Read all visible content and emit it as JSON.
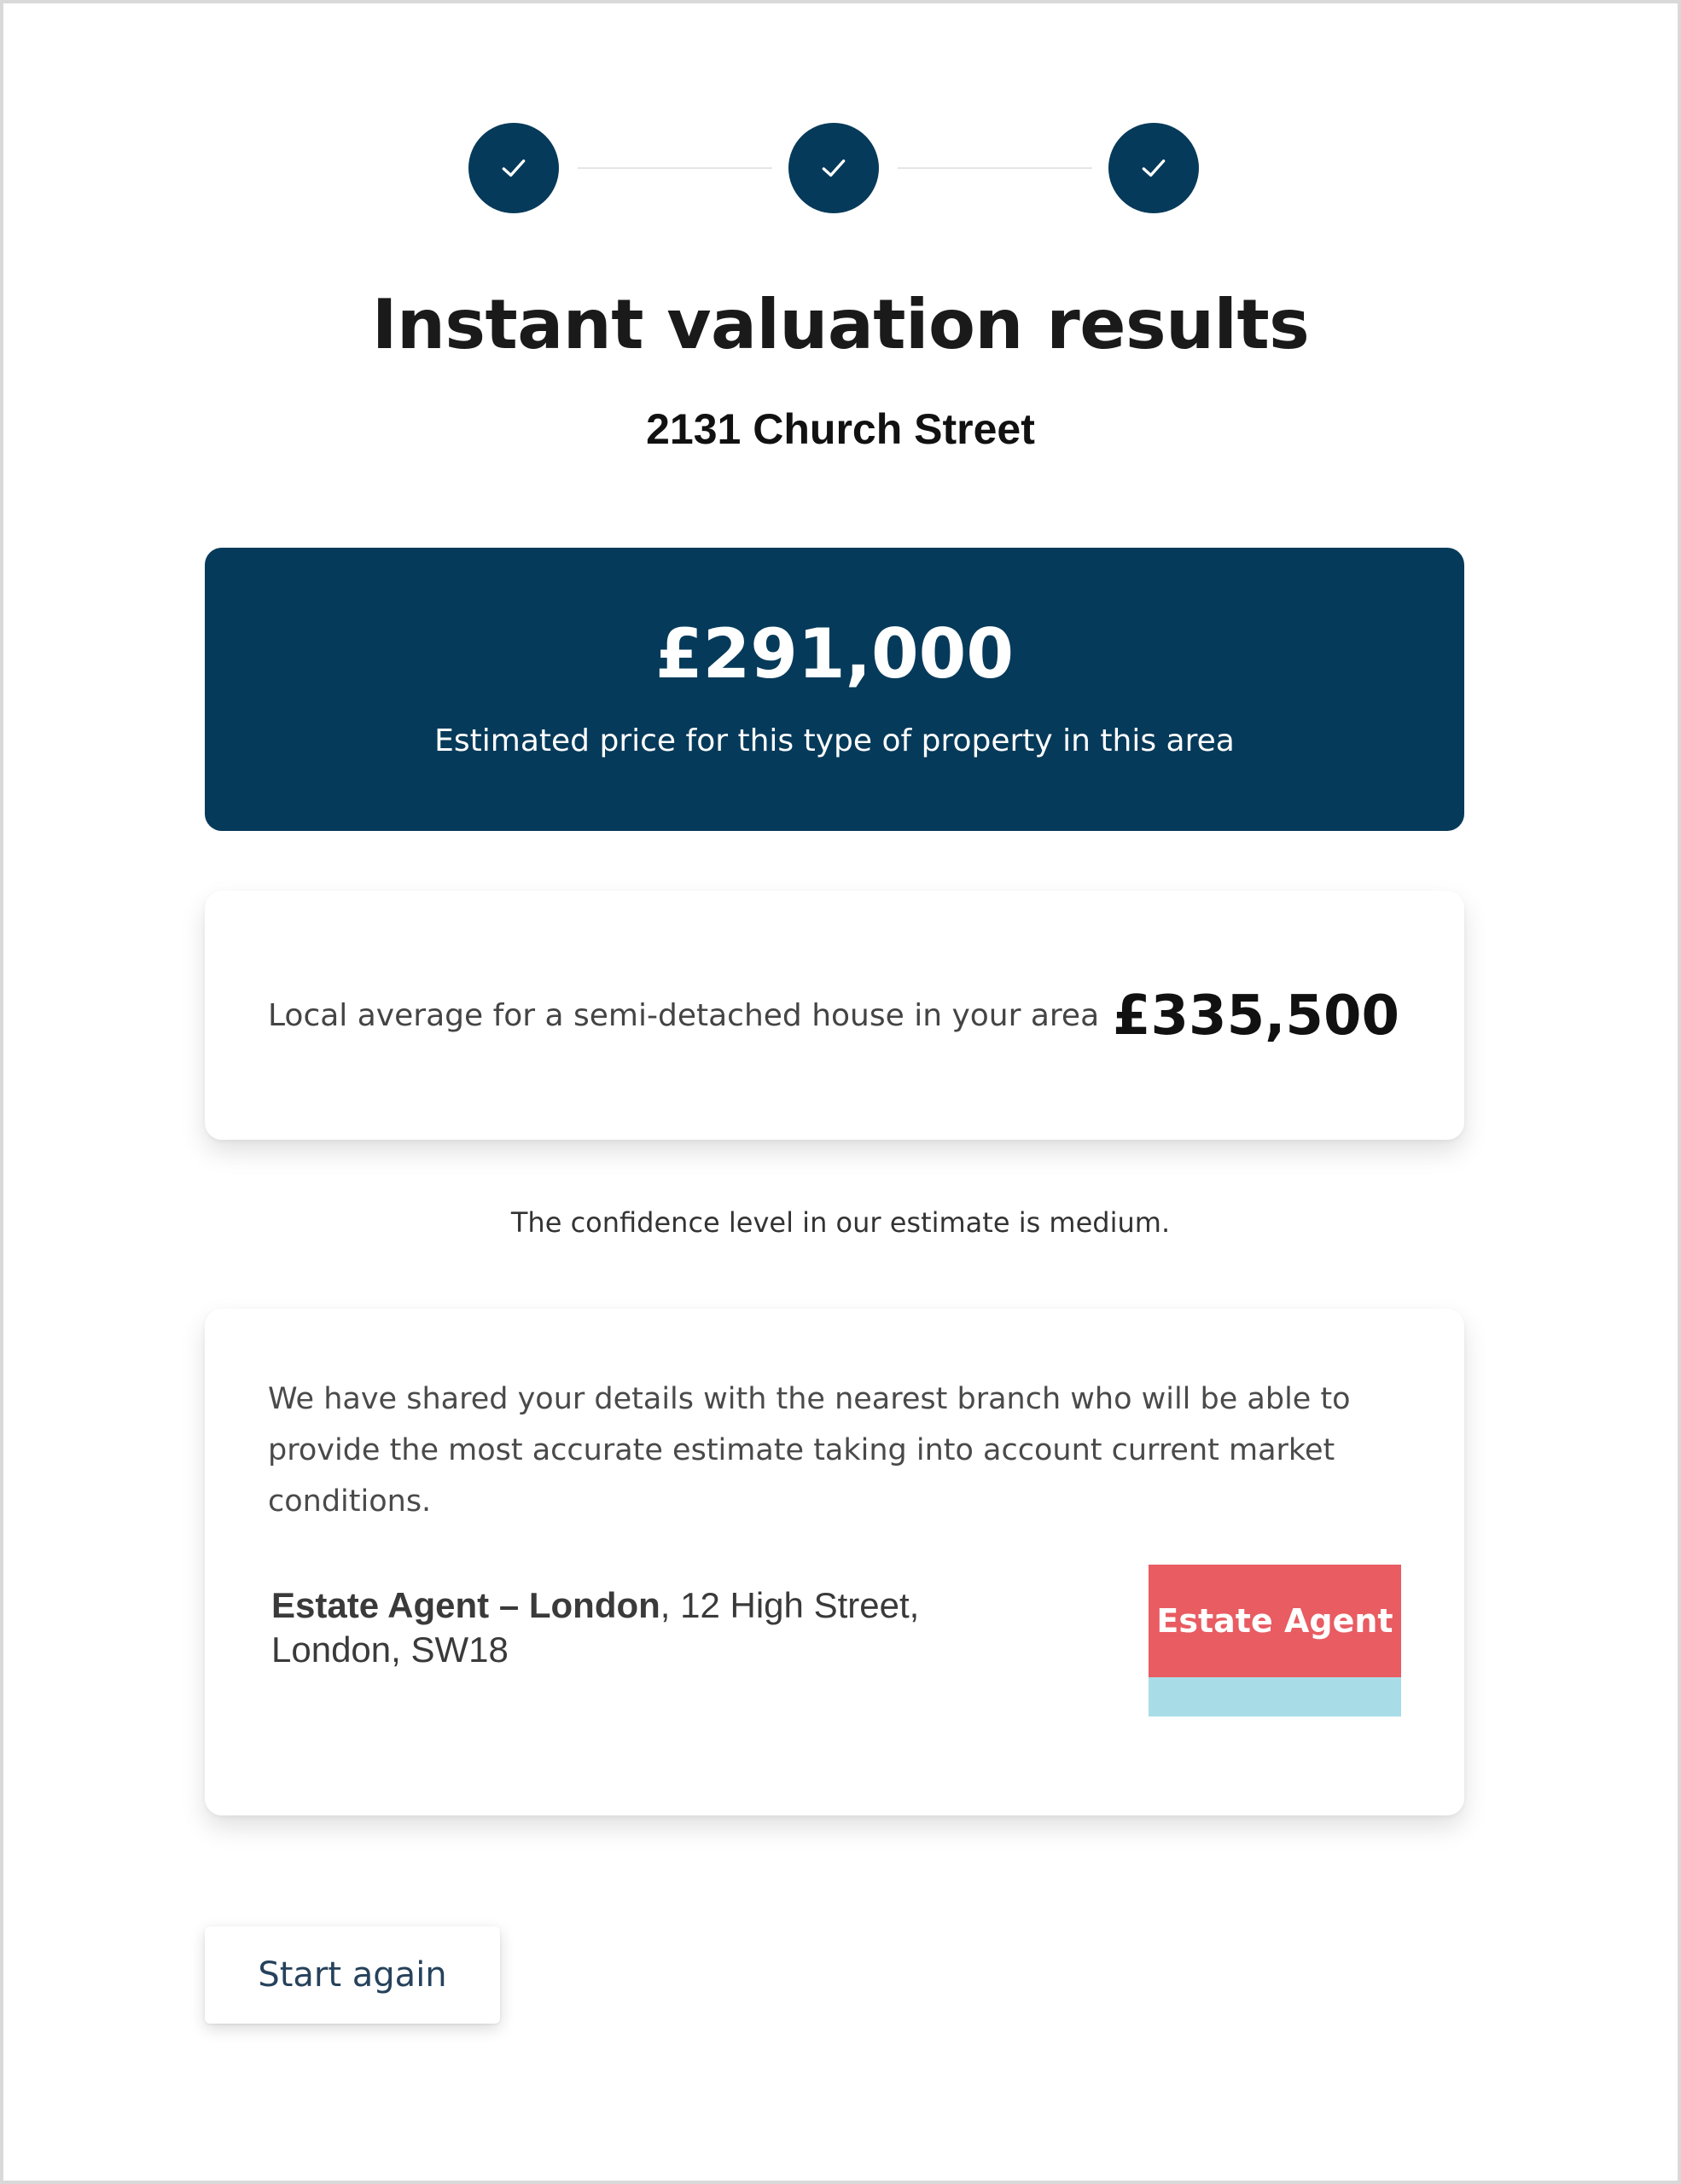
{
  "stepper": {
    "steps": [
      {
        "state": "complete",
        "icon": "check-icon"
      },
      {
        "state": "complete",
        "icon": "check-icon"
      },
      {
        "state": "complete",
        "icon": "check-icon"
      }
    ]
  },
  "header": {
    "title": "Instant valuation results",
    "address": "2131 Church Street"
  },
  "estimate": {
    "price": "£291,000",
    "description": "Estimated price for this type of property in this area"
  },
  "local_average": {
    "label": "Local average for a semi-detached house in your area",
    "value": "£335,500"
  },
  "confidence_text": "The confidence level in our estimate is medium.",
  "agent": {
    "message": "We have shared your details with the nearest branch who will be able to provide the most accurate estimate taking into account current market conditions.",
    "name": "Estate Agent – London",
    "address_line1": ", 12 High Street,",
    "address_line2": "London, SW18",
    "logo_text": "Estate Agent"
  },
  "actions": {
    "start_again": "Start again"
  },
  "colors": {
    "primary": "#063a5a",
    "logo_red": "#e85c62",
    "logo_blue": "#a8dde8"
  }
}
